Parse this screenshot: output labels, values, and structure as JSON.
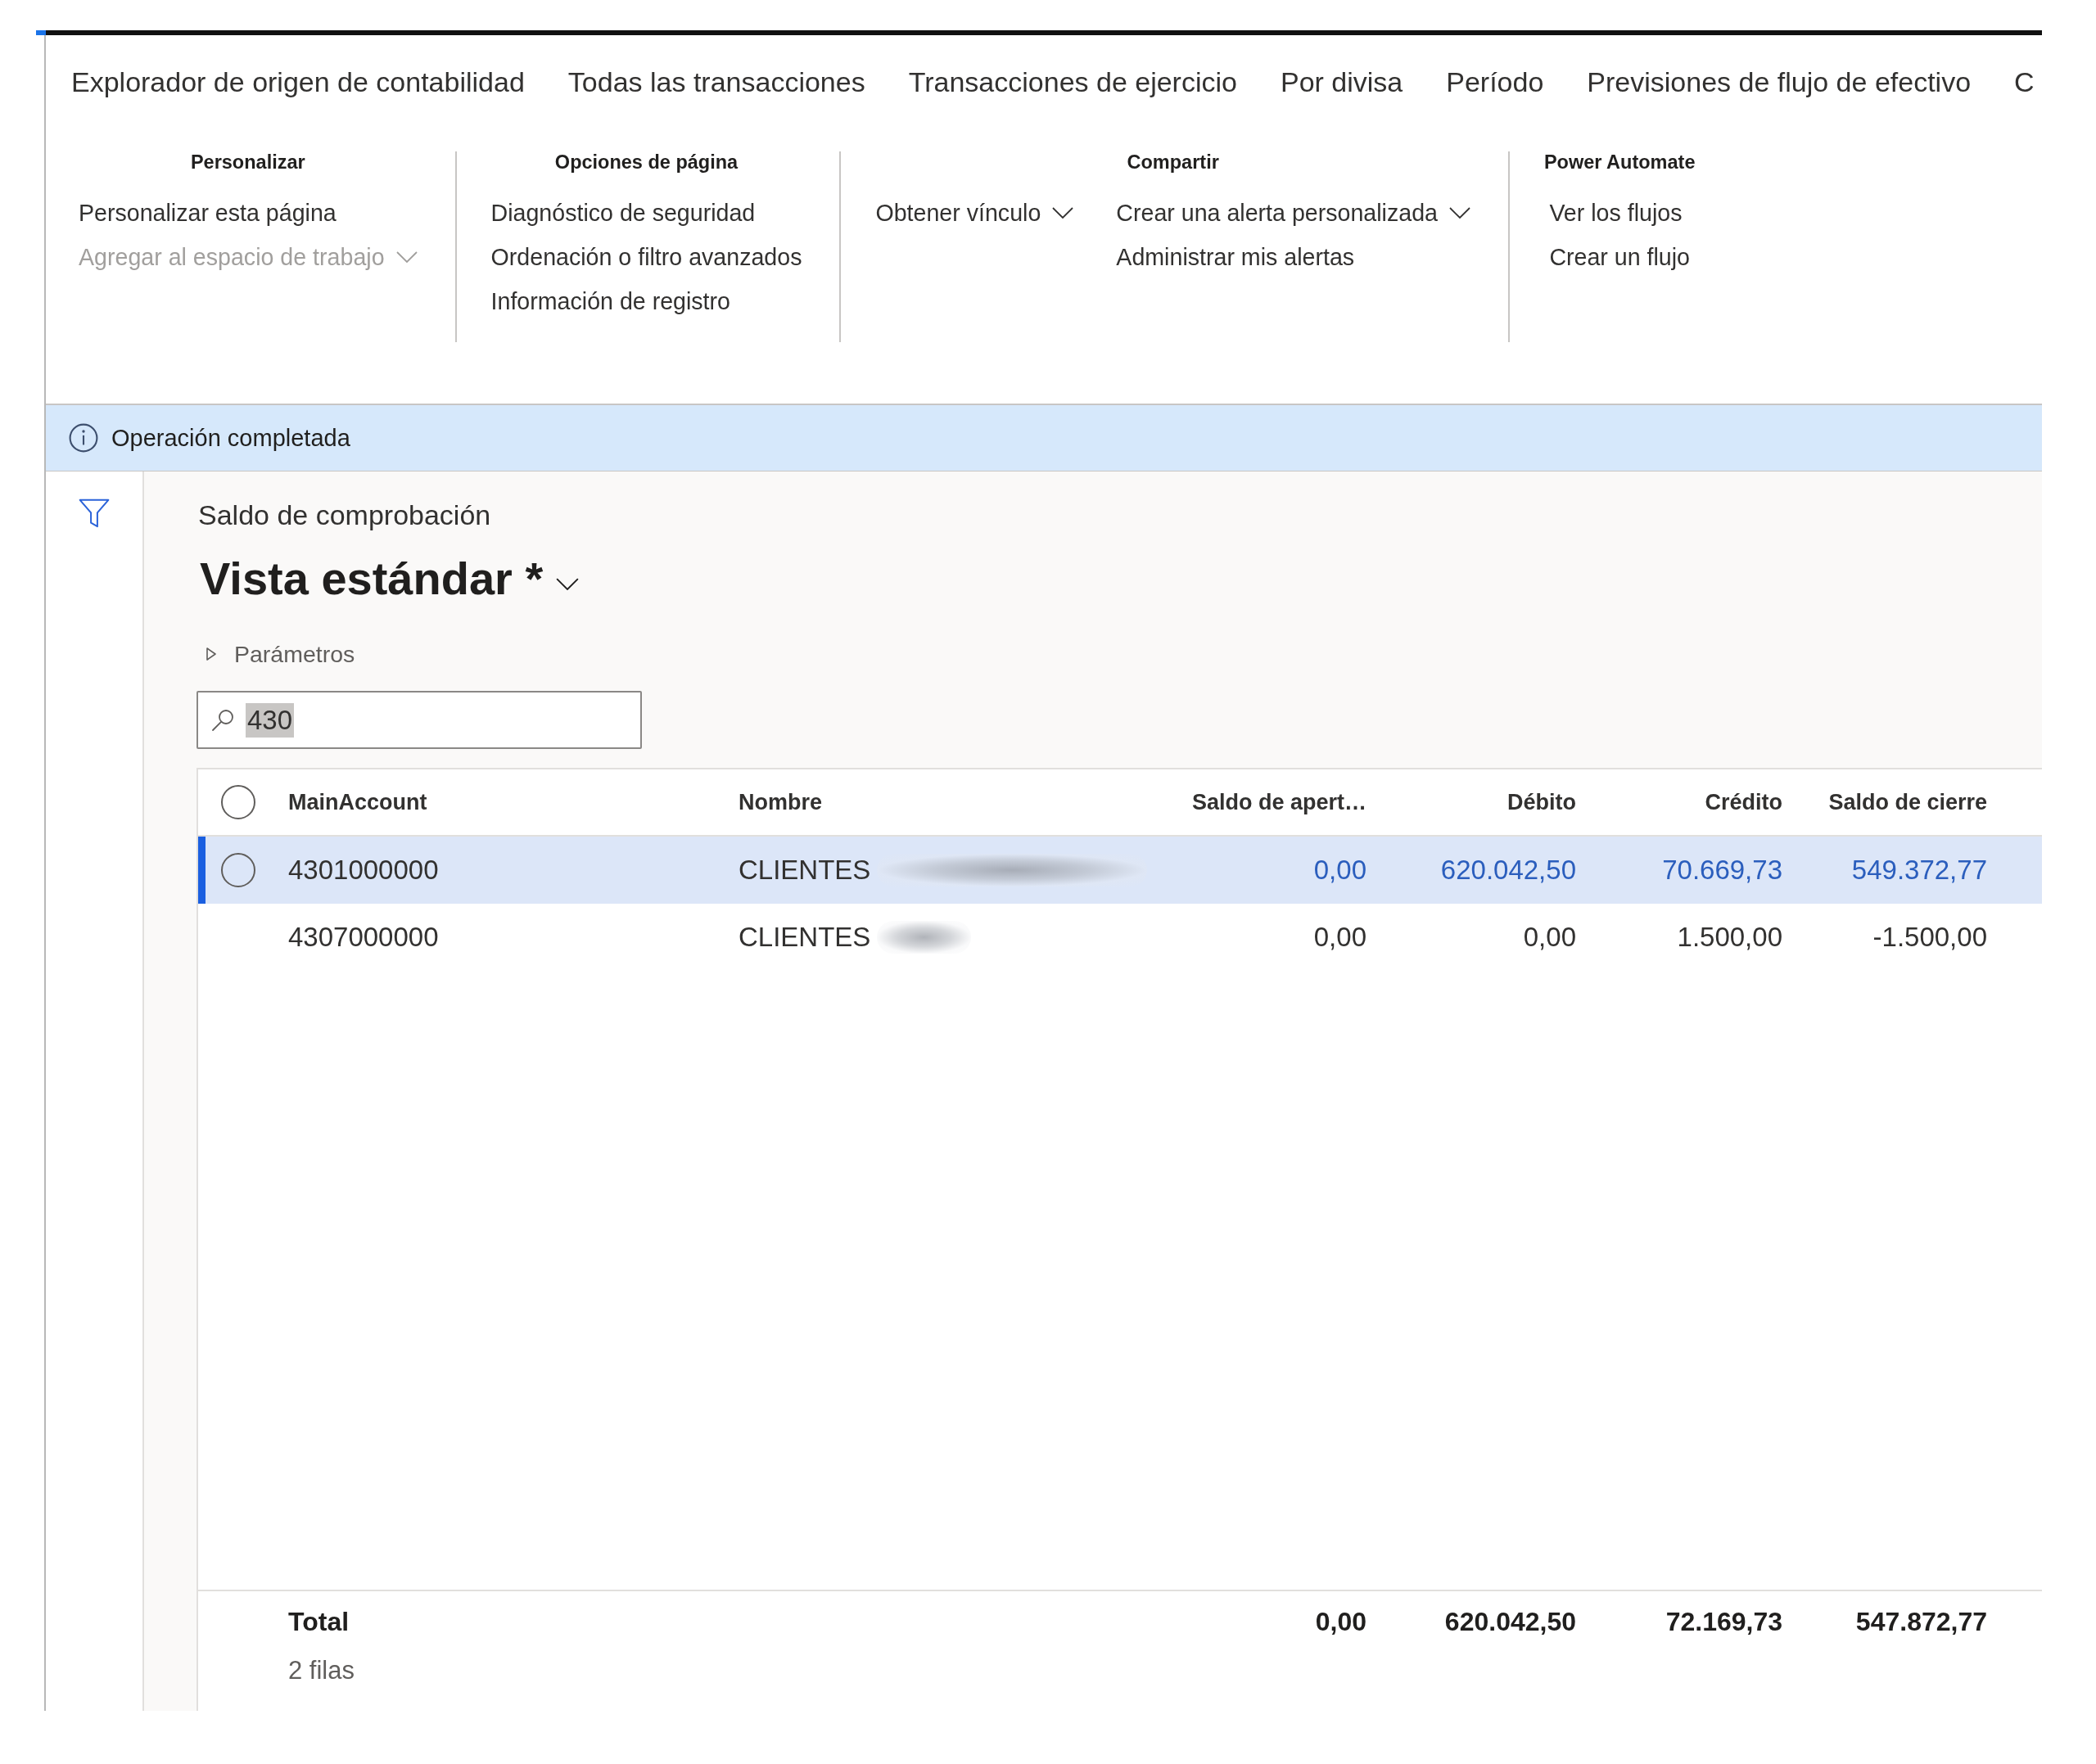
{
  "tabs": [
    {
      "label": "Explorador de origen de contabilidad"
    },
    {
      "label": "Todas las transacciones"
    },
    {
      "label": "Transacciones de ejercicio"
    },
    {
      "label": "Por divisa"
    },
    {
      "label": "Período"
    },
    {
      "label": "Previsiones de flujo de efectivo"
    },
    {
      "label": "C"
    }
  ],
  "ribbon": {
    "groups": [
      {
        "title": "Personalizar",
        "columns": [
          {
            "items": [
              {
                "label": "Personalizar esta página",
                "disabled": false,
                "dropdown": false
              },
              {
                "label": "Agregar al espacio de trabajo",
                "disabled": true,
                "dropdown": true
              }
            ]
          }
        ]
      },
      {
        "title": "Opciones de página",
        "columns": [
          {
            "items": [
              {
                "label": "Diagnóstico de seguridad",
                "disabled": false,
                "dropdown": false
              },
              {
                "label": "Ordenación o filtro avanzados",
                "disabled": false,
                "dropdown": false
              },
              {
                "label": "Información de registro",
                "disabled": false,
                "dropdown": false
              }
            ]
          }
        ]
      },
      {
        "title": "Compartir",
        "columns": [
          {
            "items": [
              {
                "label": "Obtener vínculo",
                "disabled": false,
                "dropdown": true
              }
            ]
          },
          {
            "items": [
              {
                "label": "Crear una alerta personalizada",
                "disabled": false,
                "dropdown": true
              },
              {
                "label": "Administrar mis alertas",
                "disabled": false,
                "dropdown": false
              }
            ]
          }
        ]
      },
      {
        "title": "Power Automate",
        "columns": [
          {
            "items": [
              {
                "label": "Ver los flujos",
                "disabled": false,
                "dropdown": false
              },
              {
                "label": "Crear un flujo",
                "disabled": false,
                "dropdown": false
              }
            ]
          }
        ]
      }
    ]
  },
  "message_bar": {
    "kind": "info",
    "text": "Operación completada"
  },
  "page": {
    "caption": "Saldo de comprobación",
    "view_title": "Vista estándar *",
    "parameters": {
      "label": "Parámetros",
      "expanded": false
    },
    "search": {
      "value": "430",
      "value_selected": true
    }
  },
  "grid": {
    "select_all_checked": false,
    "columns": [
      {
        "label": "MainAccount",
        "kind": "text"
      },
      {
        "label": "Nombre",
        "kind": "text"
      },
      {
        "label": "Saldo de apert…",
        "kind": "amount"
      },
      {
        "label": "Débito",
        "kind": "amount"
      },
      {
        "label": "Crédito",
        "kind": "amount"
      },
      {
        "label": "Saldo de cierre",
        "kind": "amount"
      }
    ],
    "rows": [
      {
        "selected": true,
        "cells": [
          {
            "text": "4301000000"
          },
          {
            "text": "CLIENTES",
            "redacted": true,
            "redaction_long": true
          },
          {
            "text": "0,00"
          },
          {
            "text": "620.042,50"
          },
          {
            "text": "70.669,73"
          },
          {
            "text": "549.372,77"
          }
        ]
      },
      {
        "selected": false,
        "cells": [
          {
            "text": "4307000000"
          },
          {
            "text": "CLIENTES",
            "redacted": true,
            "redaction_long": false
          },
          {
            "text": "0,00"
          },
          {
            "text": "0,00"
          },
          {
            "text": "1.500,00"
          },
          {
            "text": "-1.500,00"
          }
        ]
      }
    ],
    "footer": {
      "label": "Total",
      "totals": [
        "0,00",
        "620.042,50",
        "72.169,73",
        "547.872,77"
      ],
      "row_count": "2 filas"
    }
  }
}
